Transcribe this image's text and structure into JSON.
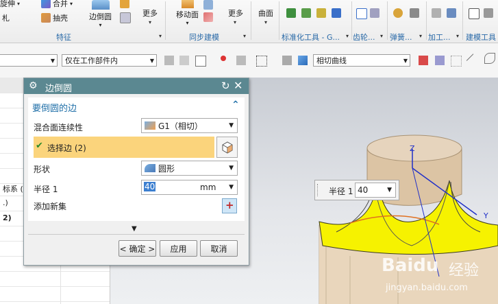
{
  "ribbon": {
    "items": {
      "xuanshen": "旋伸",
      "hebing": "合并",
      "choujiao": "抽壳",
      "bianmian": "边倒圆",
      "gengduo1": "更多",
      "yidongmian": "移动面",
      "gengduo2": "更多",
      "qumian": "曲面"
    },
    "groups": {
      "tezheng": "特征",
      "tongbu": "同步建模",
      "biaozhun": "标准化工具 - G...",
      "chilun": "齿轮...",
      "tanhuang": "弹簧...",
      "jiagong": "加工...",
      "jianmo": "建模工具"
    }
  },
  "toolbar2": {
    "filter_scope": "仅在工作部件内",
    "curve_rule": "相切曲线"
  },
  "leftpanel": {
    "row_text_1": "标系 (",
    "row_text_2": ".)",
    "row_text_3": "2)"
  },
  "dialog": {
    "title": "边倒圆",
    "section_title": "要倒圆的边",
    "continuity_label": "混合面连续性",
    "continuity_value": "G1（相切）",
    "select_edge_label": "选择边 (2)",
    "shape_label": "形状",
    "shape_value": "圆形",
    "radius_label": "半径 1",
    "radius_value": "40",
    "radius_unit": "mm",
    "add_set_label": "添加新集",
    "ok_button": "< 确定 >",
    "apply_button": "应用",
    "cancel_button": "取消"
  },
  "float_input": {
    "label": "半径 1",
    "value": "40"
  },
  "viewport": {
    "axis_z": "Z",
    "axis_y": "Y"
  },
  "watermark": {
    "brand": "Baidu",
    "brand_cn": "经验",
    "site": "jingyan.baidu.com"
  },
  "colors": {
    "title_bar": "#5b8891",
    "highlight_row": "#fbd47c",
    "section_title": "#1f6fa8",
    "fillet_yellow": "#f6f200",
    "solid_tan": "#e3cdb1"
  }
}
